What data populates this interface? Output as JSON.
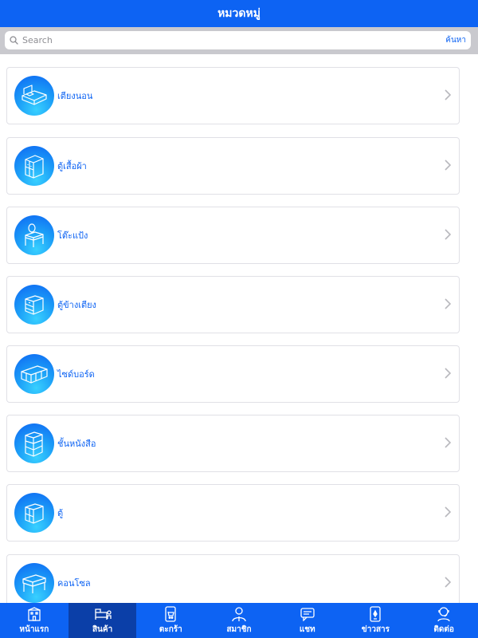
{
  "header": {
    "title": "หมวดหมู่"
  },
  "search": {
    "placeholder": "Search",
    "button_label": "ค้นหา"
  },
  "categories": [
    {
      "label": "เตียงนอน",
      "icon": "bed-icon"
    },
    {
      "label": "ตู้เสื้อผ้า",
      "icon": "wardrobe-icon"
    },
    {
      "label": "โต๊ะแป้ง",
      "icon": "dressing-table-icon"
    },
    {
      "label": "ตู้ข้างเตียง",
      "icon": "nightstand-icon"
    },
    {
      "label": "ไซด์บอร์ด",
      "icon": "sideboard-icon"
    },
    {
      "label": "ชั้นหนังสือ",
      "icon": "bookshelf-icon"
    },
    {
      "label": "ตู้",
      "icon": "cabinet-icon"
    },
    {
      "label": "คอนโซล",
      "icon": "console-table-icon"
    }
  ],
  "tabs": [
    {
      "label": "หน้าแรก",
      "icon": "home-icon",
      "active": false
    },
    {
      "label": "สินค้า",
      "icon": "products-icon",
      "active": true
    },
    {
      "label": "ตะกร้า",
      "icon": "cart-icon",
      "active": false
    },
    {
      "label": "สมาชิก",
      "icon": "member-icon",
      "active": false
    },
    {
      "label": "แชท",
      "icon": "chat-icon",
      "active": false
    },
    {
      "label": "ข่าวสาร",
      "icon": "news-icon",
      "active": false
    },
    {
      "label": "ติดต่อ",
      "icon": "contact-icon",
      "active": false
    }
  ],
  "colors": {
    "brand": "#0d63f3",
    "active_tab": "#0b3fa8",
    "search_bg": "#c9c9ce"
  }
}
